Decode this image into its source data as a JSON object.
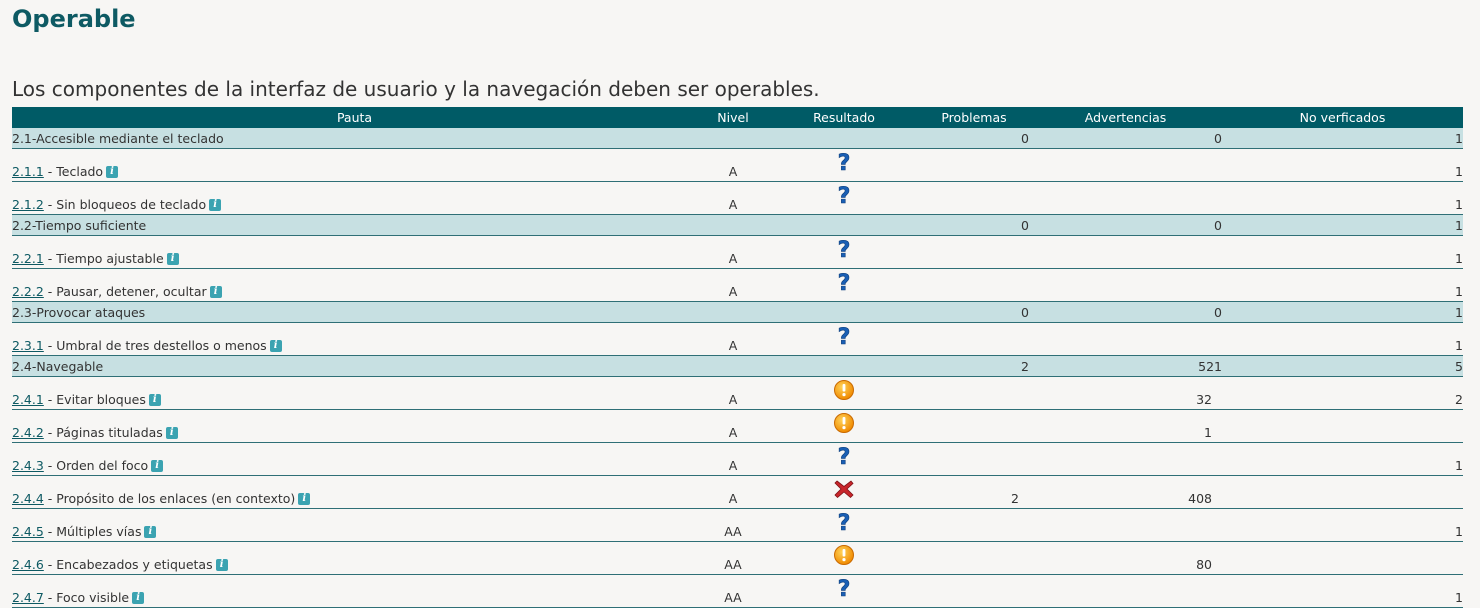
{
  "page": {
    "title": "Operable",
    "subtitle": "Los componentes de la interfaz de usuario y la navegación deben ser operables."
  },
  "table": {
    "headers": {
      "pauta": "Pauta",
      "nivel": "Nivel",
      "resultado": "Resultado",
      "problemas": "Problemas",
      "advertencias": "Advertencias",
      "no_verificados": "No verficados"
    },
    "rows": [
      {
        "type": "section",
        "label": "2.1-Accesible mediante el teclado",
        "problemas": "0",
        "advertencias": "0",
        "no_verificados": "1"
      },
      {
        "type": "item",
        "code": "2.1.1",
        "label": " - Teclado",
        "nivel": "A",
        "result": "question-icon",
        "problemas": "",
        "advertencias": "",
        "no_verificados": "1"
      },
      {
        "type": "item",
        "code": "2.1.2",
        "label": " - Sin bloqueos de teclado",
        "nivel": "A",
        "result": "question-icon",
        "problemas": "",
        "advertencias": "",
        "no_verificados": "1"
      },
      {
        "type": "section",
        "label": "2.2-Tiempo suficiente",
        "problemas": "0",
        "advertencias": "0",
        "no_verificados": "1"
      },
      {
        "type": "item",
        "code": "2.2.1",
        "label": " - Tiempo ajustable",
        "nivel": "A",
        "result": "question-icon",
        "problemas": "",
        "advertencias": "",
        "no_verificados": "1"
      },
      {
        "type": "item",
        "code": "2.2.2",
        "label": " - Pausar, detener, ocultar",
        "nivel": "A",
        "result": "question-icon",
        "problemas": "",
        "advertencias": "",
        "no_verificados": "1"
      },
      {
        "type": "section",
        "label": "2.3-Provocar ataques",
        "problemas": "0",
        "advertencias": "0",
        "no_verificados": "1"
      },
      {
        "type": "item",
        "code": "2.3.1",
        "label": " - Umbral de tres destellos o menos",
        "nivel": "A",
        "result": "question-icon",
        "problemas": "",
        "advertencias": "",
        "no_verificados": "1"
      },
      {
        "type": "section",
        "label": "2.4-Navegable",
        "problemas": "2",
        "advertencias": "521",
        "no_verificados": "5"
      },
      {
        "type": "item",
        "code": "2.4.1",
        "label": " - Evitar bloques",
        "nivel": "A",
        "result": "warning-icon",
        "problemas": "",
        "advertencias": "32",
        "no_verificados": "2"
      },
      {
        "type": "item",
        "code": "2.4.2",
        "label": " - Páginas tituladas",
        "nivel": "A",
        "result": "warning-icon",
        "problemas": "",
        "advertencias": "1",
        "no_verificados": ""
      },
      {
        "type": "item",
        "code": "2.4.3",
        "label": " - Orden del foco",
        "nivel": "A",
        "result": "question-icon",
        "problemas": "",
        "advertencias": "",
        "no_verificados": "1"
      },
      {
        "type": "item",
        "code": "2.4.4",
        "label": " - Propósito de los enlaces (en contexto)",
        "nivel": "A",
        "result": "error-icon",
        "problemas": "2",
        "advertencias": "408",
        "no_verificados": ""
      },
      {
        "type": "item",
        "code": "2.4.5",
        "label": " - Múltiples vías",
        "nivel": "AA",
        "result": "question-icon",
        "problemas": "",
        "advertencias": "",
        "no_verificados": "1"
      },
      {
        "type": "item",
        "code": "2.4.6",
        "label": " - Encabezados y etiquetas",
        "nivel": "AA",
        "result": "warning-icon",
        "problemas": "",
        "advertencias": "80",
        "no_verificados": ""
      },
      {
        "type": "item",
        "code": "2.4.7",
        "label": " - Foco visible",
        "nivel": "AA",
        "result": "question-icon",
        "problemas": "",
        "advertencias": "",
        "no_verificados": "1"
      }
    ]
  },
  "colors": {
    "header_bg": "#005b66",
    "section_bg": "#c7e0e2",
    "title": "#0e5a63",
    "info_icon": "#3ba3b1"
  }
}
